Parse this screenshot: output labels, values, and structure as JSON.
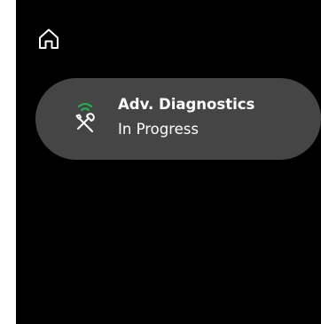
{
  "header": {
    "home_icon": "home-icon"
  },
  "status_card": {
    "title": "Adv. Diagnostics",
    "status": "In Progress",
    "icon": "tools-wireless-icon",
    "signal_color": "#1db954"
  }
}
